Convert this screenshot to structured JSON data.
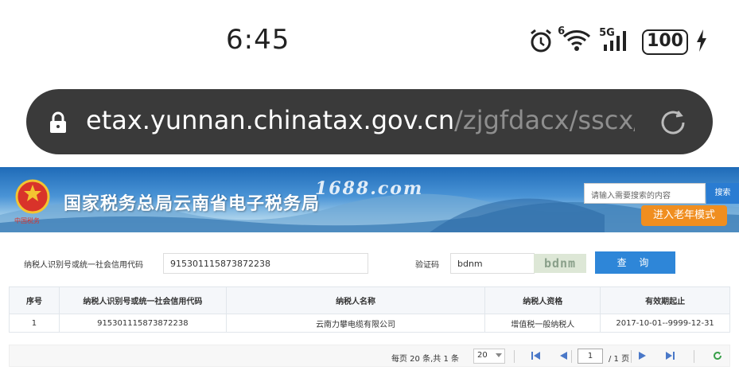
{
  "status": {
    "time": "6:45",
    "signal_small": "6",
    "network": "5G",
    "battery": "100"
  },
  "browser": {
    "url_main": "etax.yunnan.chinatax.gov.cn",
    "url_path": "/zjgfdacx/sscx/ybr"
  },
  "banner": {
    "title": "国家税务总局云南省电子税务局",
    "watermark": "1688.com",
    "search_placeholder": "请输入需要搜索的内容",
    "search_button": "搜索",
    "elder_mode_button": "进入老年模式"
  },
  "query": {
    "taxid_label": "纳税人识别号或统一社会信用代码",
    "taxid_value": "915301115873872238",
    "captcha_label": "验证码",
    "captcha_value": "bdnm",
    "captcha_image_text": "bdnm",
    "query_button": "查 询"
  },
  "table": {
    "headers": [
      "序号",
      "纳税人识别号或统一社会信用代码",
      "纳税人名称",
      "纳税人资格",
      "有效期起止"
    ],
    "rows": [
      [
        "1",
        "915301115873872238",
        "云南力攀电缆有限公司",
        "增值税一般纳税人",
        "2017-10-01--9999-12-31"
      ]
    ]
  },
  "pager": {
    "info": "每页 20 条,共 1 条",
    "page_size": "20",
    "current_page": "1",
    "total_pages": "/ 1 页"
  }
}
